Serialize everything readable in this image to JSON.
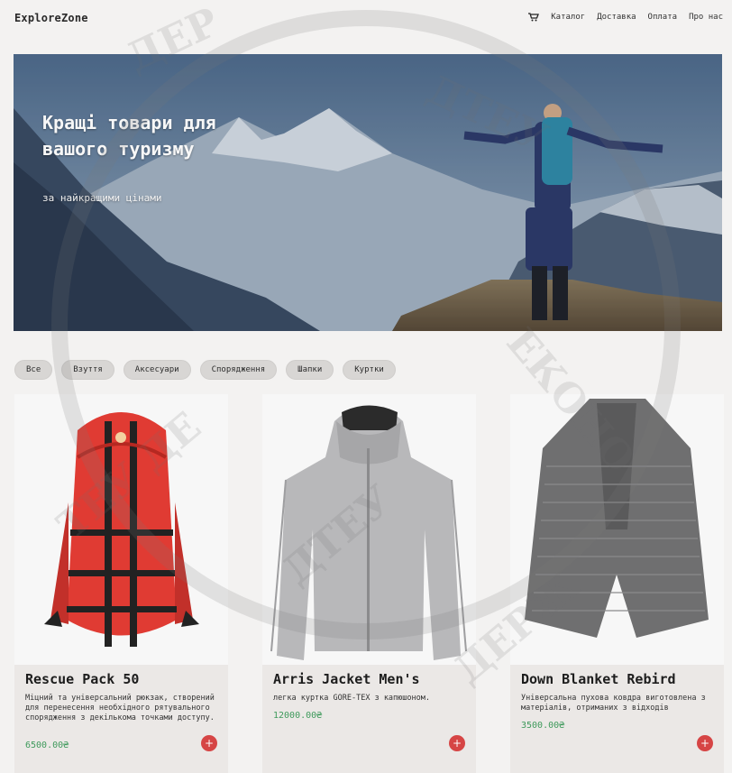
{
  "brand": "ExploreZone",
  "nav": {
    "cart_icon": "shopping-cart-icon",
    "items": [
      "Каталог",
      "Доставка",
      "Оплата",
      "Про нас"
    ]
  },
  "hero": {
    "title": "Кращі товари для вашого туризму",
    "subtitle": "за найкращими цінами"
  },
  "filters": [
    "Все",
    "Взуття",
    "Аксесуари",
    "Спорядження",
    "Шапки",
    "Куртки"
  ],
  "products": [
    {
      "name": "Rescue Pack 50",
      "description": "Міцний та універсальний рюкзак, створений для перенесення необхідного рятувального спорядження з декількома точками доступу.",
      "price": "6500.00₴",
      "add_label": "+"
    },
    {
      "name": "Arris Jacket Men's",
      "description": "легка куртка GORE-TEX з капюшоном.",
      "price": "12000.00₴",
      "add_label": "+"
    },
    {
      "name": "Down Blanket Rebird",
      "description": "Універсальна пухова ковдра виготовлена з матеріалів, отриманих з відходів",
      "price": "3500.00₴",
      "add_label": "+"
    }
  ],
  "colors": {
    "background": "#f3f2f1",
    "card": "#ebe8e6",
    "price": "#3f9a5c",
    "add_button": "#d64545",
    "chip": "#d8d6d4"
  }
}
